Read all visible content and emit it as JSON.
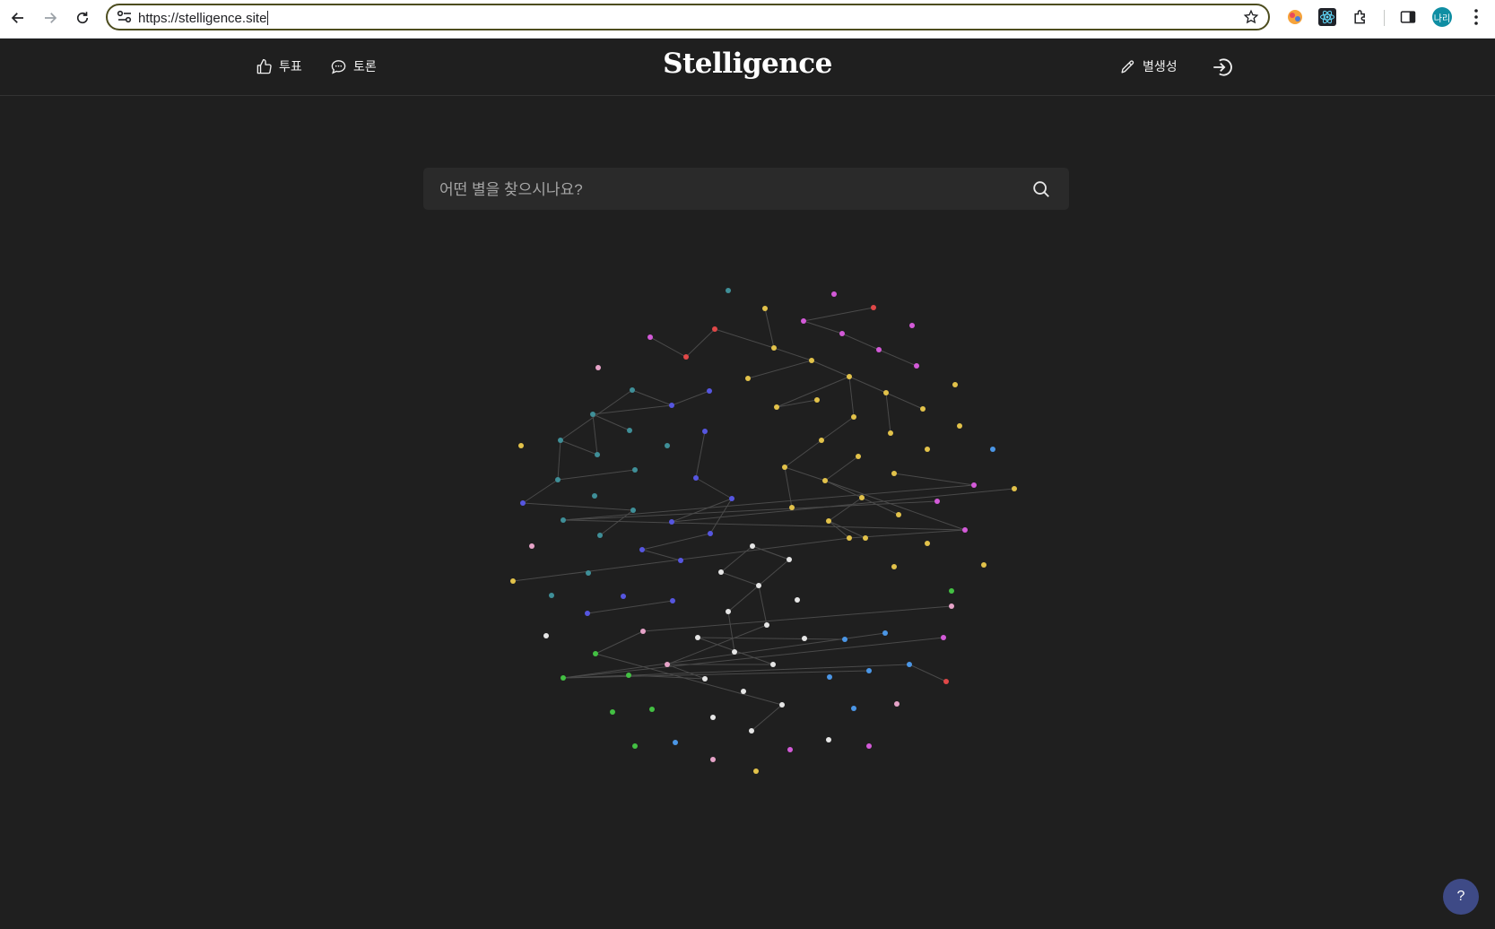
{
  "browser": {
    "url": "https://stelligence.site",
    "profile_initial": "나리"
  },
  "header": {
    "nav": [
      {
        "label": "투표",
        "icon": "thumbs-up-icon"
      },
      {
        "label": "토론",
        "icon": "chat-icon"
      }
    ],
    "logo": "Stelligence",
    "create_label": "별생성",
    "create_icon": "pencil-icon",
    "logout_icon": "logout-icon"
  },
  "search": {
    "placeholder": "어떤 별을 찾으시나요?",
    "value": "",
    "icon": "search-icon"
  },
  "help": {
    "label": "?"
  },
  "colors": {
    "background": "#1f1f1f",
    "link": "#4a4a4a",
    "yellow": "#e2c24a",
    "magenta": "#d35ad8",
    "teal": "#3f8f98",
    "indigo": "#5656e0",
    "white": "#e6e6e6",
    "blue": "#4b96e6",
    "green": "#43c043",
    "red": "#e04848",
    "pink": "#e6a3c8"
  }
}
